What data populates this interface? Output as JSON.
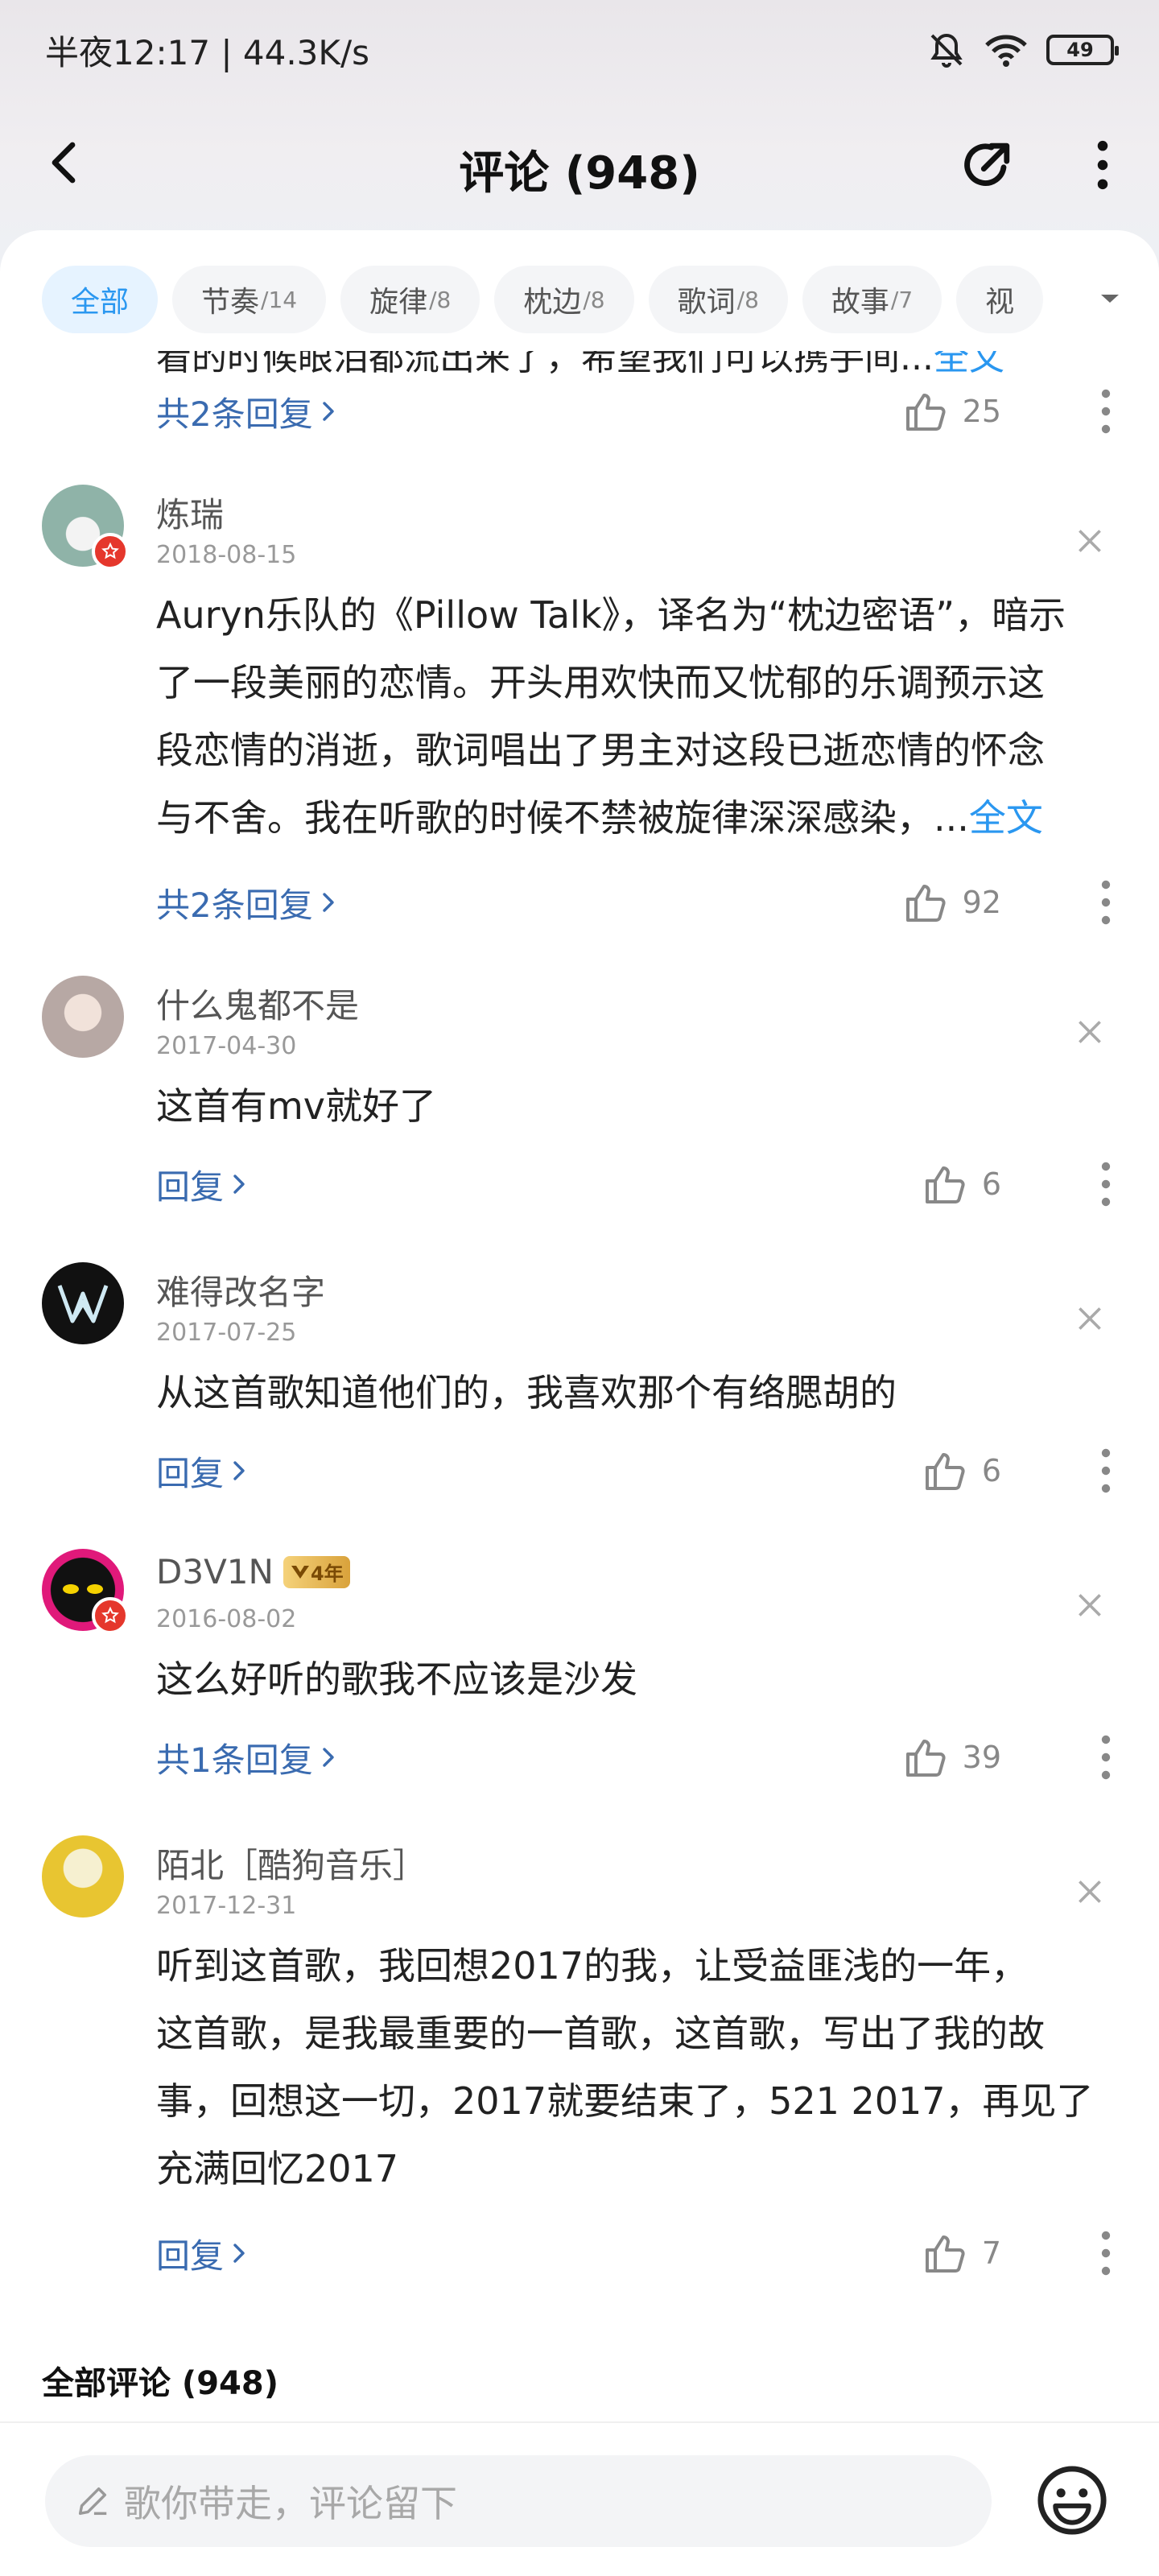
{
  "status": {
    "time": "半夜12:17 | 44.3K/s",
    "battery": "49"
  },
  "header": {
    "title": "评论 (948)"
  },
  "tabs": [
    {
      "label": "全部",
      "count": ""
    },
    {
      "label": "节奏",
      "count": "/14"
    },
    {
      "label": "旋律",
      "count": "/8"
    },
    {
      "label": "枕边",
      "count": "/8"
    },
    {
      "label": "歌词",
      "count": "/8"
    },
    {
      "label": "故事",
      "count": "/7"
    },
    {
      "label": "视",
      "count": ""
    }
  ],
  "partial": {
    "text": "看的时候眼泪都流出来了，希望我们可以携手间...",
    "full_link": "全文",
    "reply": "共2条回复",
    "likes": "25"
  },
  "comments": [
    {
      "user": "炼瑞",
      "date": "2018-08-15",
      "lines": [
        "Auryn乐队的《Pillow Talk》，译名为“枕边密语”，暗示",
        "了一段美丽的恋情。开头用欢快而又忧郁的乐调预示这",
        "段恋情的消逝，歌词唱出了男主对这段已逝恋情的怀念",
        "与不舍。我在听歌的时候不禁被旋律深深感染，..."
      ],
      "full_link": "全文",
      "reply": "共2条回复",
      "likes": "92"
    },
    {
      "user": "什么鬼都不是",
      "date": "2017-04-30",
      "lines": [
        "这首有mv就好了"
      ],
      "reply": "回复",
      "likes": "6"
    },
    {
      "user": "难得改名字",
      "date": "2017-07-25",
      "lines": [
        "从这首歌知道他们的，我喜欢那个有络腮胡的"
      ],
      "reply": "回复",
      "likes": "6"
    },
    {
      "user": "D3V1N",
      "vip": "4年",
      "date": "2016-08-02",
      "lines": [
        "这么好听的歌我不应该是沙发"
      ],
      "reply": "共1条回复",
      "likes": "39"
    },
    {
      "user": "陌北［酷狗音乐］",
      "date": "2017-12-31",
      "lines": [
        "听到这首歌，我回想2017的我，让受益匪浅的一年，",
        "这首歌，是我最重要的一首歌，这首歌，写出了我的故",
        "事，回想这一切，2017就要结束了，521  2017，再见了",
        "充满回忆2017"
      ],
      "reply": "回复",
      "likes": "7"
    }
  ],
  "section_title": "全部评论 (948)",
  "composer": {
    "placeholder": "歌你带走，评论留下"
  },
  "colors": {
    "accent": "#2a97f0",
    "reply": "#3a6bb0",
    "badge_red": "#e5372c"
  }
}
